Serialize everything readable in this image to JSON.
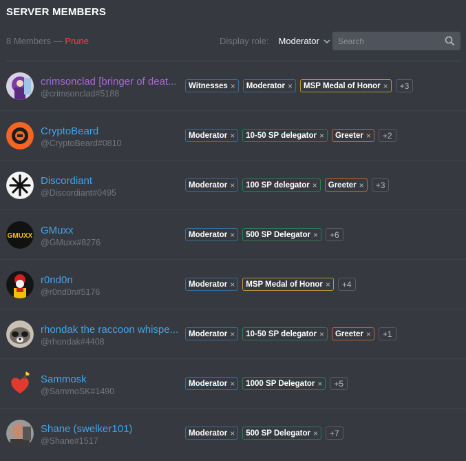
{
  "header": {
    "title": "SERVER MEMBERS",
    "member_count": "8 Members",
    "separator": "—",
    "prune_label": "Prune",
    "display_role_label": "Display role:",
    "display_role_value": "Moderator",
    "search_placeholder": "Search"
  },
  "colors": {
    "background": "#36393f",
    "name_blue": "#43a3e8",
    "name_purple": "#a867d6",
    "prune_red": "#f04747",
    "role_blue": "#3d6e94",
    "role_green": "#2f7d55",
    "role_gold": "#b69a3b",
    "role_orange": "#bf6b3a"
  },
  "members": [
    {
      "name": "crimsonclad [bringer of deat...",
      "tag": "@crimsonclad#5188",
      "avatar_icon": "crimsonclad-avatar",
      "roles": [
        "Witnesses",
        "Moderator",
        "MSP Medal of Honor"
      ],
      "more": "+3"
    },
    {
      "name": "CryptoBeard",
      "tag": "@CryptoBeard#0810",
      "avatar_icon": "cryptobeard-avatar",
      "roles": [
        "Moderator",
        "10-50 SP delegator",
        "Greeter"
      ],
      "more": "+2"
    },
    {
      "name": "Discordiant",
      "tag": "@Discordiant#0495",
      "avatar_icon": "discordiant-avatar",
      "roles": [
        "Moderator",
        "100 SP delegator",
        "Greeter"
      ],
      "more": "+3"
    },
    {
      "name": "GMuxx",
      "tag": "@GMuxx#8276",
      "avatar_icon": "gmuxx-avatar",
      "avatar_text": "GMUXX",
      "roles": [
        "Moderator",
        "500 SP Delegator"
      ],
      "more": "+6"
    },
    {
      "name": "r0nd0n",
      "tag": "@r0nd0n#5176",
      "avatar_icon": "r0nd0n-avatar",
      "roles": [
        "Moderator",
        "MSP Medal of Honor"
      ],
      "more": "+4"
    },
    {
      "name": "rhondak the raccoon whispe...",
      "tag": "@rhondak#4408",
      "avatar_icon": "raccoon-avatar",
      "roles": [
        "Moderator",
        "10-50 SP delegator",
        "Greeter"
      ],
      "more": "+1"
    },
    {
      "name": "Sammosk",
      "tag": "@SammoSK#1490",
      "avatar_icon": "bomb-heart-avatar",
      "roles": [
        "Moderator",
        "1000 SP Delegator"
      ],
      "more": "+5"
    },
    {
      "name": "Shane (swelker101)",
      "tag": "@Shane#1517",
      "avatar_icon": "shane-avatar",
      "roles": [
        "Moderator",
        "500 SP Delegator"
      ],
      "more": "+7"
    }
  ]
}
